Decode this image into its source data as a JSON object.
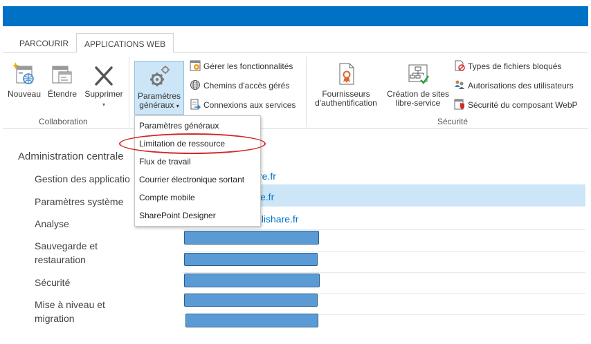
{
  "tabs": [
    {
      "label": "PARCOURIR",
      "selected": false
    },
    {
      "label": "APPLICATIONS WEB",
      "selected": true
    }
  ],
  "ribbon": {
    "collaboration": {
      "label": "Collaboration",
      "buttons": [
        {
          "label": "Nouveau",
          "icon": "new-app-icon"
        },
        {
          "label": "Étendre",
          "icon": "extend-icon"
        },
        {
          "label": "Supprimer",
          "icon": "delete-x-icon"
        }
      ]
    },
    "manage": {
      "button_line1": "Paramètres",
      "button_line2": "généraux",
      "button_icon": "gears-icon",
      "small_buttons": [
        {
          "label": "Gérer les fonctionnalités",
          "icon": "features-icon"
        },
        {
          "label": "Chemins d'accès gérés",
          "icon": "globe-icon"
        },
        {
          "label": "Connexions aux services",
          "icon": "service-connections-icon"
        }
      ]
    },
    "security": {
      "label": "Sécurité",
      "buttons": [
        {
          "line1": "Fournisseurs",
          "line2": "d'authentification",
          "icon": "auth-provider-icon"
        },
        {
          "line1": "Création de sites",
          "line2": "libre-service",
          "icon": "site-creation-icon"
        }
      ],
      "small_buttons": [
        {
          "label": "Types de fichiers bloqués",
          "icon": "blocked-file-icon"
        },
        {
          "label": "Autorisations des utilisateurs",
          "icon": "user-permissions-icon"
        },
        {
          "label": "Sécurité du composant WebP",
          "icon": "webpart-security-icon"
        }
      ]
    }
  },
  "dropdown": {
    "items": [
      "Paramètres généraux",
      "Limitation de ressource",
      "Flux de travail",
      "Courrier électronique sortant",
      "Compte mobile",
      "SharePoint Designer"
    ],
    "highlighted_index": 1
  },
  "nav": {
    "heading": "Administration centrale",
    "items": [
      "Gestion des applicatio",
      "Paramètres système",
      "Analyse",
      "Sauvegarde et restauration",
      "Sécurité",
      "Mise à niveau et migration"
    ]
  },
  "list": {
    "visible_links": [
      "re.fr",
      "e.fr",
      "alishare.fr"
    ]
  },
  "colors": {
    "brand_bar": "#0072c6",
    "selection": "#cde6f7",
    "annotation_circle": "#d42828",
    "redaction": "#5b9bd5"
  }
}
